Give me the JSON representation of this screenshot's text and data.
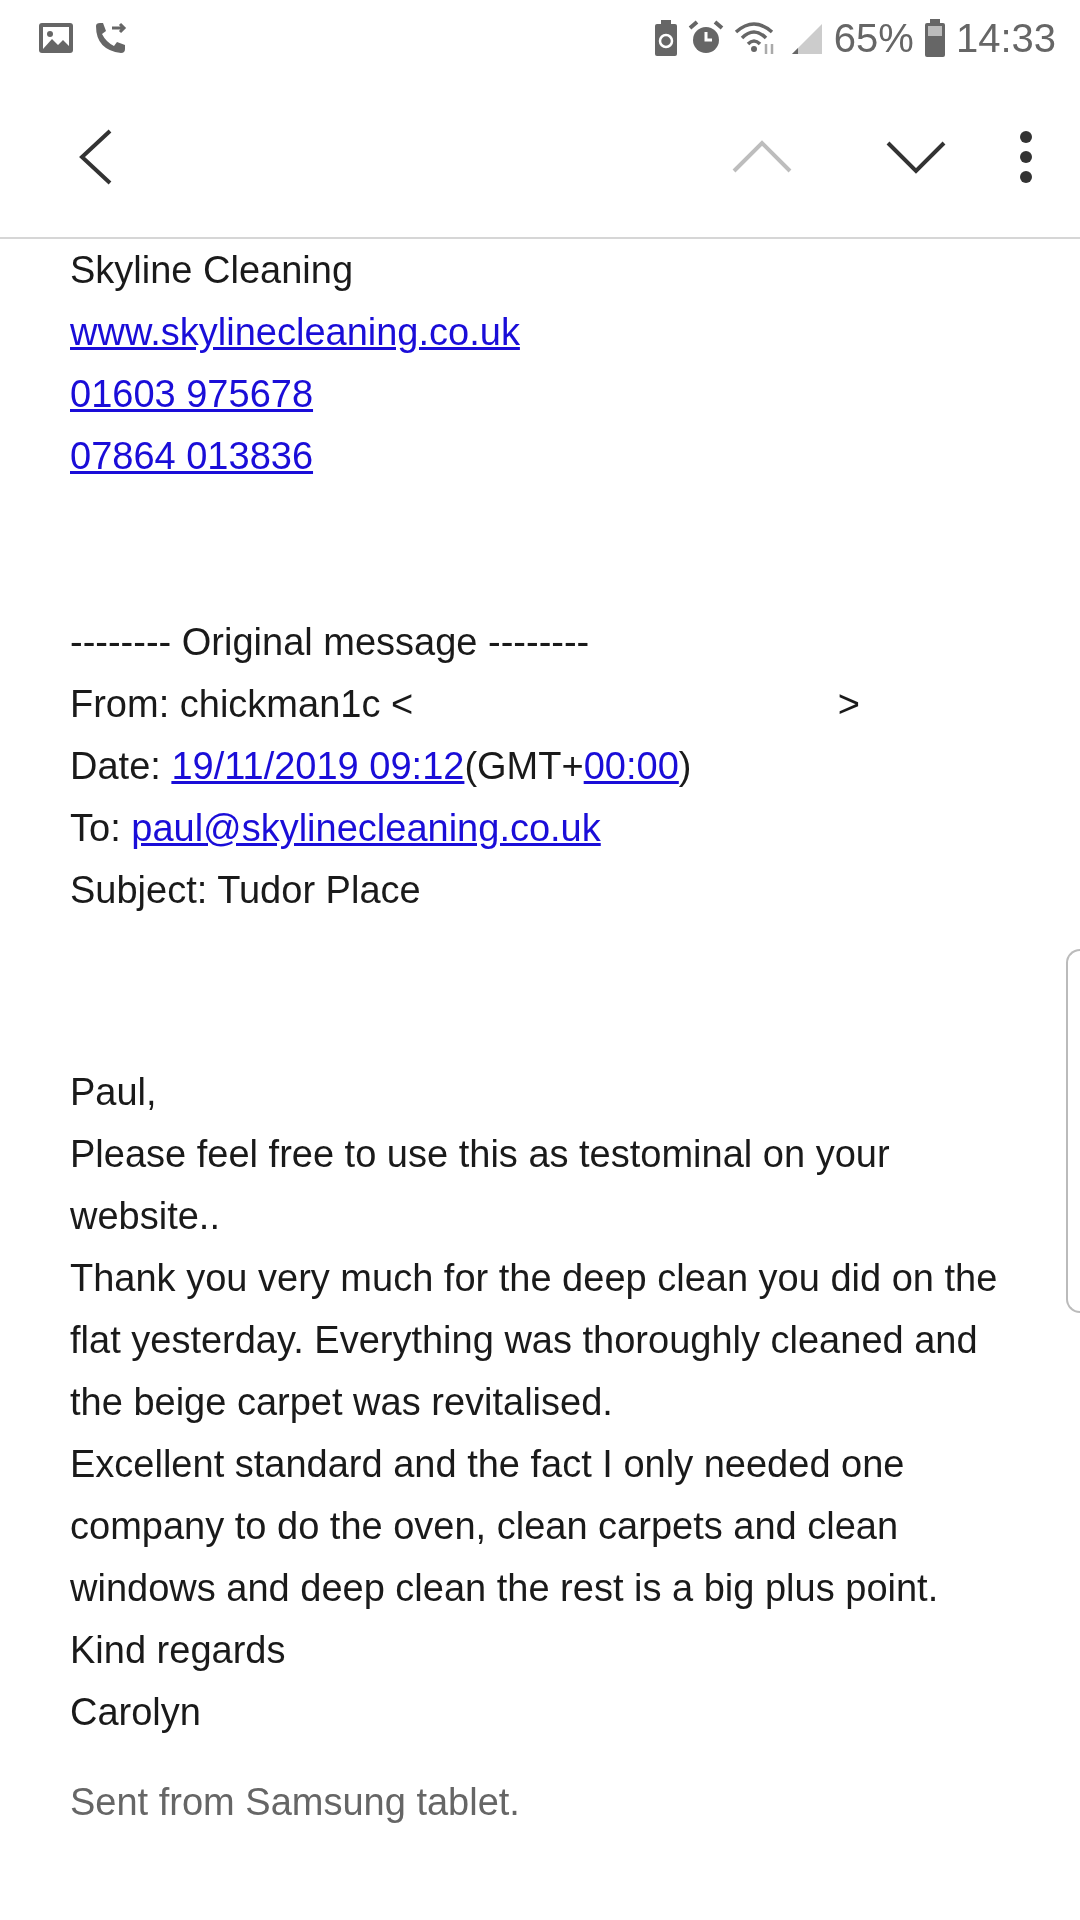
{
  "status_bar": {
    "battery": "65%",
    "time": "14:33"
  },
  "toolbar": {
    "previous_disabled": true
  },
  "signature": [
    {
      "kind": "text",
      "text": "Skyline Cleaning"
    },
    {
      "kind": "link",
      "text": "www.skylinecleaning.co.uk"
    },
    {
      "kind": "link",
      "text": "01603 975678"
    },
    {
      "kind": "link",
      "text": "07864 013836"
    }
  ],
  "original_message": {
    "divider": "-------- Original message --------",
    "from": [
      {
        "kind": "text",
        "text": "From: chickman1c <"
      },
      {
        "kind": "gap",
        "text": ">"
      }
    ],
    "date": [
      {
        "kind": "text",
        "text": "Date: "
      },
      {
        "kind": "link",
        "text": "19/11/2019 09:12 "
      },
      {
        "kind": "text",
        "text": "(GMT+"
      },
      {
        "kind": "link",
        "text": "00:00"
      },
      {
        "kind": "text",
        "text": ")"
      }
    ],
    "to": [
      {
        "kind": "text",
        "text": "To: "
      },
      {
        "kind": "link",
        "text": "paul@skylinecleaning.co.uk"
      }
    ],
    "subject": [
      {
        "kind": "text",
        "text": "Subject: Tudor Place"
      }
    ]
  },
  "body": [
    "Paul,",
    "Please feel free to use this as testominal on your website..",
    "Thank you very much for the deep clean you did on the flat yesterday. Everything was thoroughly cleaned and the beige carpet was revitalised.",
    "Excellent standard and the fact I only needed one company to do the oven, clean carpets and clean windows and deep clean the rest is a big plus point.",
    "Kind regards",
    "Carolyn"
  ],
  "footer": "Sent from Samsung tablet."
}
